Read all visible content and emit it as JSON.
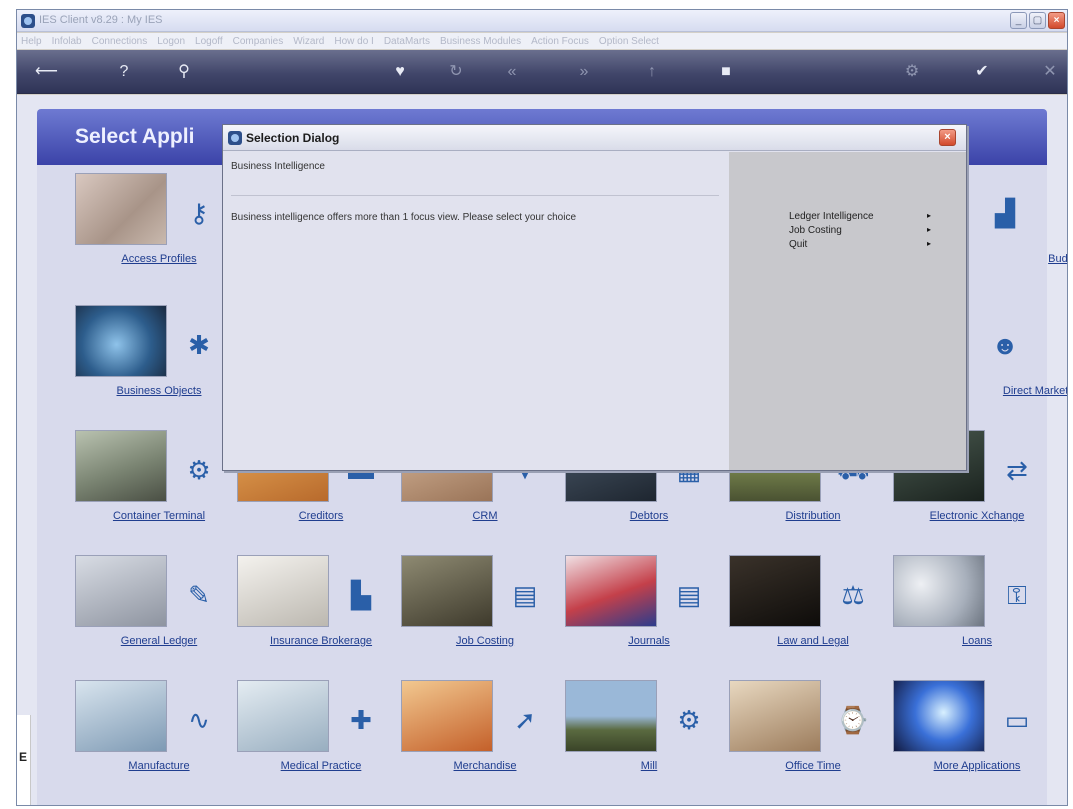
{
  "window": {
    "title": "IES Client v8.29 : My IES",
    "menu": [
      "Help",
      "Infolab",
      "Connections",
      "Logon",
      "Logoff",
      "Companies",
      "Wizard",
      "How do I",
      "DataMarts",
      "Business Modules",
      "Action Focus",
      "Option Select"
    ]
  },
  "toolbar": {
    "icons": [
      "back-arrow-icon",
      "help-icon",
      "search-icon",
      "heart-icon",
      "refresh-icon",
      "rewind-icon",
      "forward-icon",
      "up-icon",
      "stop-icon",
      "settings-icon",
      "check-icon",
      "close-icon"
    ]
  },
  "page": {
    "header_title": "Select Appli"
  },
  "tiles": [
    {
      "label": "Access Profiles",
      "icon": "key-icon",
      "photo": "#b8a9a0"
    },
    {
      "label": "Budget",
      "icon": "chart-icon",
      "photo": "#6f6660"
    },
    {
      "label": "Business Objects",
      "icon": "puzzle-icon",
      "photo": "#3d6b96"
    },
    {
      "label": "Direct Marketing",
      "icon": "people-icon",
      "photo": "#3f4a52"
    },
    {
      "label": "Container Terminal",
      "icon": "gears-icon",
      "photo": "#7e8678"
    },
    {
      "label": "Creditors",
      "icon": "creditors-icon",
      "photo": "#c8803a"
    },
    {
      "label": "CRM",
      "icon": "crm-icon",
      "photo": "#b89478"
    },
    {
      "label": "Debtors",
      "icon": "debtors-icon",
      "photo": "#2c3744"
    },
    {
      "label": "Distribution",
      "icon": "truck-icon",
      "photo": "#6e7458"
    },
    {
      "label": "Electronic Xchange",
      "icon": "exchange-icon",
      "photo": "#2f3a34"
    },
    {
      "label": "General Ledger",
      "icon": "pen-icon",
      "photo": "#9a9ea8"
    },
    {
      "label": "Insurance Brokerage",
      "icon": "insurance-icon",
      "photo": "#d8d4cc"
    },
    {
      "label": "Job Costing",
      "icon": "costing-icon",
      "photo": "#5e5a48"
    },
    {
      "label": "Journals",
      "icon": "journal-icon",
      "photo": "#b33a44"
    },
    {
      "label": "Law and Legal",
      "icon": "legal-icon",
      "photo": "#2a2420"
    },
    {
      "label": "Loans",
      "icon": "loans-icon",
      "photo": "#c8ccd4"
    },
    {
      "label": "Manufacture",
      "icon": "wave-icon",
      "photo": "#90a8c0"
    },
    {
      "label": "Medical Practice",
      "icon": "medical-icon",
      "photo": "#b8c8d6"
    },
    {
      "label": "Merchandise",
      "icon": "merchandise-icon",
      "photo": "#c87848"
    },
    {
      "label": "Mill",
      "icon": "mill-icon",
      "photo": "#6a88a8"
    },
    {
      "label": "Office Time",
      "icon": "office-icon",
      "photo": "#c8b49a"
    },
    {
      "label": "More Applications",
      "icon": "monitor-icon",
      "photo": "#2a5fc8"
    }
  ],
  "dialog": {
    "title": "Selection Dialog",
    "heading": "Business Intelligence",
    "message": "Business intelligence offers more than 1 focus view. Please select your choice",
    "options": [
      {
        "label": "Ledger Intelligence",
        "arrow": "▸"
      },
      {
        "label": "Job Costing",
        "arrow": "▸"
      },
      {
        "label": "Quit",
        "arrow": "▸"
      }
    ]
  },
  "leftstrip": {
    "letter": "E"
  }
}
